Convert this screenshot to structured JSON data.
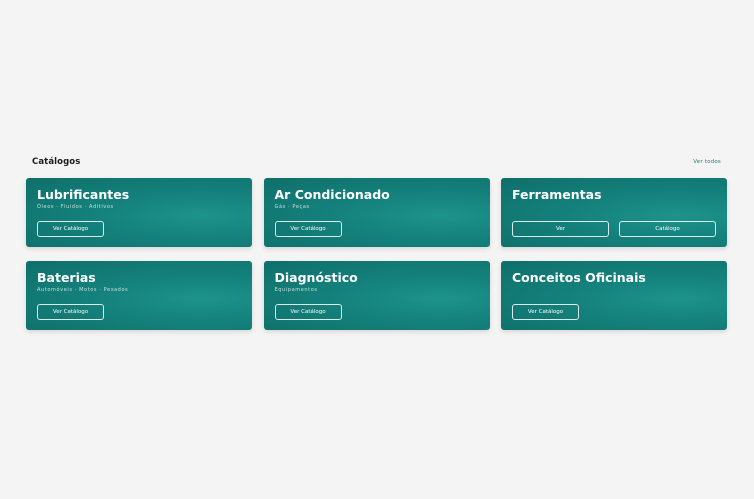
{
  "section": {
    "title": "Catálogos",
    "see_all": "Ver todos"
  },
  "cards": [
    {
      "title": "Lubrificantes",
      "subtitle": "Óleos · Fluidos · Aditivos",
      "button": "Ver Catálogo"
    },
    {
      "title": "Ar Condicionado",
      "subtitle": "Gás · Peças",
      "button": "Ver Catálogo"
    },
    {
      "title": "Ferramentas",
      "subtitle": "",
      "buttons": [
        "Ver",
        "Catálogo"
      ]
    },
    {
      "title": "Baterias",
      "subtitle": "Automóveis · Motos · Pesados",
      "button": "Ver Catálogo"
    },
    {
      "title": "Diagnóstico",
      "subtitle": "Equipamentos",
      "button": "Ver Catálogo"
    },
    {
      "title": "Conceitos Oficinais",
      "subtitle": "",
      "button": "Ver Catálogo"
    }
  ]
}
